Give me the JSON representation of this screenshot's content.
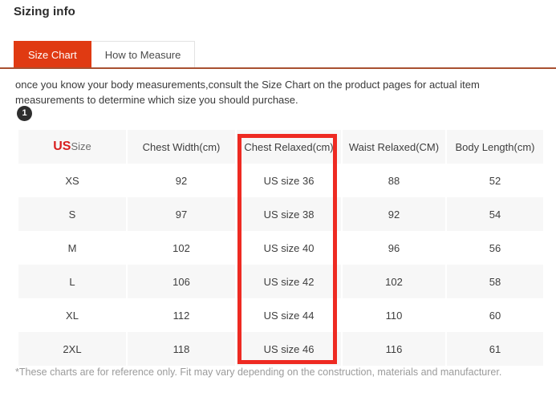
{
  "page": {
    "title": "Sizing info"
  },
  "tabs": [
    {
      "label": "Size Chart",
      "active": true
    },
    {
      "label": "How to Measure",
      "active": false
    }
  ],
  "intro": {
    "text": "once you know your body measurements,consult the Size Chart on the product pages for actual item measurements to determine which size you should purchase."
  },
  "step_badge": {
    "number": "1"
  },
  "table": {
    "headers": {
      "us_size_strong": "US",
      "us_size_light": "Size",
      "chest_width": "Chest Width(cm)",
      "chest_relaxed": "Chest Relaxed(cm)",
      "waist_relaxed": "Waist Relaxed(CM)",
      "body_length": "Body Length(cm)"
    },
    "rows": [
      {
        "size": "XS",
        "chest_width": "92",
        "chest_relaxed": "US size 36",
        "waist_relaxed": "88",
        "body_length": "52"
      },
      {
        "size": "S",
        "chest_width": "97",
        "chest_relaxed": "US size 38",
        "waist_relaxed": "92",
        "body_length": "54"
      },
      {
        "size": "M",
        "chest_width": "102",
        "chest_relaxed": "US size 40",
        "waist_relaxed": "96",
        "body_length": "56"
      },
      {
        "size": "L",
        "chest_width": "106",
        "chest_relaxed": "US size 42",
        "waist_relaxed": "102",
        "body_length": "58"
      },
      {
        "size": "XL",
        "chest_width": "112",
        "chest_relaxed": "US size 44",
        "waist_relaxed": "110",
        "body_length": "60"
      },
      {
        "size": "2XL",
        "chest_width": "118",
        "chest_relaxed": "US size 46",
        "waist_relaxed": "116",
        "body_length": "61"
      }
    ]
  },
  "footnote": {
    "text": "*These charts are for reference only. Fit may vary depending on the construction, materials and manufacturer."
  },
  "colors": {
    "accent_orange": "#e03a12",
    "rule_brown": "#a85030",
    "size_red": "#d81f1f",
    "annotation_red": "#ee2a22",
    "row_alt": "#f7f7f7",
    "badge_dark": "#2e2e2e"
  }
}
